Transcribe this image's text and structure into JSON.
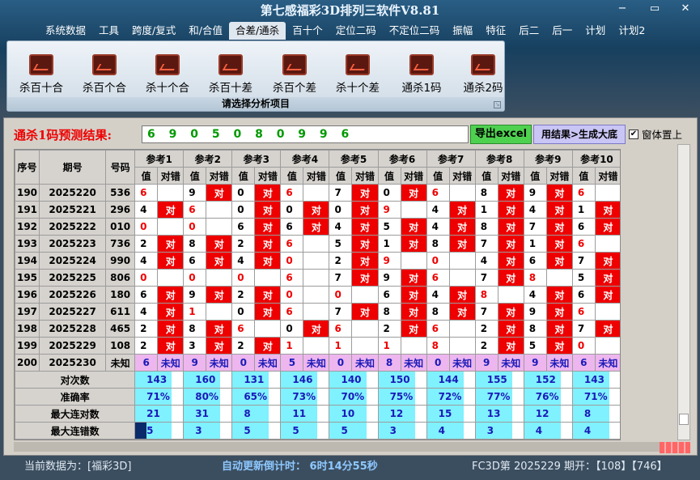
{
  "app": {
    "title": "第七感福彩3D排列三软件V8.81"
  },
  "window_controls": {
    "minimize": "−",
    "restore": "▭",
    "close": "✕"
  },
  "menu": [
    "系统数据",
    "工具",
    "跨度/复式",
    "和/合值",
    "合差/通杀",
    "百十个",
    "定位二码",
    "不定位二码",
    "振幅",
    "特征",
    "后二",
    "后一",
    "计划",
    "计划2"
  ],
  "menu_active": 4,
  "ribbon": {
    "items": [
      "杀百十合",
      "杀百个合",
      "杀十个合",
      "杀百十差",
      "杀百个差",
      "杀十个差",
      "通杀1码",
      "通杀2码"
    ],
    "caption": "请选择分析项目",
    "icon": "chart-icon"
  },
  "prediction": {
    "label": "通杀1码预测结果:",
    "value": "6 9 0 5 0 8 0 9 9 6"
  },
  "buttons": {
    "export": "导出excel",
    "generate": "用结果>生成大底"
  },
  "topmost": {
    "label": "窗体置上",
    "checked": true
  },
  "table": {
    "headers": {
      "seq": "序号",
      "issue": "期号",
      "number": "号码",
      "refs": [
        "参考1",
        "参考2",
        "参考3",
        "参考4",
        "参考5",
        "参考6",
        "参考7",
        "参考8",
        "参考9",
        "参考10"
      ],
      "value": "值",
      "result": "对错"
    },
    "rows": [
      {
        "seq": "190",
        "issue": "2025220",
        "num": "536",
        "vals": [
          "6",
          "9",
          "0",
          "6",
          "7",
          "0",
          "6",
          "8",
          "9",
          "6"
        ],
        "res": [
          "",
          "对",
          "对",
          "",
          "对",
          "对",
          "",
          "对",
          "对",
          ""
        ],
        "hit": [
          true,
          false,
          false,
          true,
          false,
          false,
          true,
          false,
          false,
          true
        ]
      },
      {
        "seq": "191",
        "issue": "2025221",
        "num": "296",
        "vals": [
          "4",
          "6",
          "0",
          "0",
          "0",
          "9",
          "4",
          "1",
          "4",
          "1"
        ],
        "res": [
          "对",
          "",
          "对",
          "对",
          "对",
          "",
          "对",
          "对",
          "对",
          "对"
        ],
        "hit": [
          false,
          true,
          false,
          false,
          false,
          true,
          false,
          false,
          false,
          false
        ]
      },
      {
        "seq": "192",
        "issue": "2025222",
        "num": "010",
        "vals": [
          "0",
          "0",
          "6",
          "6",
          "4",
          "5",
          "4",
          "8",
          "7",
          "6"
        ],
        "res": [
          "",
          "",
          "对",
          "对",
          "对",
          "对",
          "对",
          "对",
          "对",
          "对"
        ],
        "hit": [
          true,
          true,
          false,
          false,
          false,
          false,
          false,
          false,
          false,
          false
        ]
      },
      {
        "seq": "193",
        "issue": "2025223",
        "num": "736",
        "vals": [
          "2",
          "8",
          "2",
          "6",
          "5",
          "1",
          "8",
          "7",
          "1",
          "6"
        ],
        "res": [
          "对",
          "对",
          "对",
          "",
          "对",
          "对",
          "对",
          "对",
          "对",
          ""
        ],
        "hit": [
          false,
          false,
          false,
          true,
          false,
          false,
          false,
          false,
          false,
          true
        ]
      },
      {
        "seq": "194",
        "issue": "2025224",
        "num": "990",
        "vals": [
          "4",
          "6",
          "4",
          "0",
          "2",
          "9",
          "0",
          "4",
          "6",
          "7"
        ],
        "res": [
          "对",
          "对",
          "对",
          "",
          "对",
          "",
          "",
          "对",
          "对",
          "对"
        ],
        "hit": [
          false,
          false,
          false,
          true,
          false,
          true,
          true,
          false,
          false,
          false
        ]
      },
      {
        "seq": "195",
        "issue": "2025225",
        "num": "806",
        "vals": [
          "0",
          "0",
          "0",
          "6",
          "7",
          "9",
          "6",
          "7",
          "8",
          "5"
        ],
        "res": [
          "",
          "",
          "",
          "",
          "对",
          "对",
          "",
          "对",
          "",
          "对"
        ],
        "hit": [
          true,
          true,
          true,
          true,
          false,
          false,
          true,
          false,
          true,
          false
        ]
      },
      {
        "seq": "196",
        "issue": "2025226",
        "num": "180",
        "vals": [
          "6",
          "9",
          "2",
          "0",
          "0",
          "6",
          "4",
          "8",
          "4",
          "6"
        ],
        "res": [
          "对",
          "对",
          "对",
          "",
          "",
          "对",
          "对",
          "",
          "对",
          "对"
        ],
        "hit": [
          false,
          false,
          false,
          true,
          true,
          false,
          false,
          true,
          false,
          false
        ]
      },
      {
        "seq": "197",
        "issue": "2025227",
        "num": "611",
        "vals": [
          "4",
          "1",
          "0",
          "6",
          "7",
          "8",
          "8",
          "7",
          "9",
          "6"
        ],
        "res": [
          "对",
          "",
          "对",
          "",
          "对",
          "对",
          "对",
          "对",
          "对",
          ""
        ],
        "hit": [
          false,
          true,
          false,
          true,
          false,
          false,
          false,
          false,
          false,
          true
        ]
      },
      {
        "seq": "198",
        "issue": "2025228",
        "num": "465",
        "vals": [
          "2",
          "8",
          "6",
          "0",
          "6",
          "2",
          "6",
          "2",
          "8",
          "7"
        ],
        "res": [
          "对",
          "对",
          "",
          "对",
          "",
          "对",
          "",
          "对",
          "对",
          "对"
        ],
        "hit": [
          false,
          false,
          true,
          false,
          true,
          false,
          true,
          false,
          false,
          false
        ]
      },
      {
        "seq": "199",
        "issue": "2025229",
        "num": "108",
        "vals": [
          "2",
          "3",
          "2",
          "1",
          "1",
          "1",
          "8",
          "2",
          "5",
          "0"
        ],
        "res": [
          "对",
          "对",
          "对",
          "",
          "",
          "",
          "",
          "对",
          "对",
          ""
        ],
        "hit": [
          false,
          false,
          false,
          true,
          true,
          true,
          true,
          false,
          false,
          true
        ]
      },
      {
        "seq": "200",
        "issue": "2025230",
        "num": "未知",
        "vals": [
          "6",
          "9",
          "0",
          "5",
          "0",
          "8",
          "0",
          "9",
          "9",
          "6"
        ],
        "res": [
          "未知",
          "未知",
          "未知",
          "未知",
          "未知",
          "未知",
          "未知",
          "未知",
          "未知",
          "未知"
        ],
        "hit": [
          false,
          false,
          false,
          false,
          false,
          false,
          false,
          false,
          false,
          false
        ]
      }
    ],
    "stats": [
      {
        "label": "对次数",
        "values": [
          "143",
          "160",
          "131",
          "146",
          "140",
          "150",
          "144",
          "155",
          "152",
          "143"
        ]
      },
      {
        "label": "准确率",
        "values": [
          "71%",
          "80%",
          "65%",
          "73%",
          "70%",
          "75%",
          "72%",
          "77%",
          "76%",
          "71%"
        ]
      },
      {
        "label": "最大连对数",
        "values": [
          "21",
          "31",
          "8",
          "11",
          "10",
          "12",
          "15",
          "13",
          "12",
          "8"
        ]
      },
      {
        "label": "最大连错数",
        "values": [
          "5",
          "3",
          "5",
          "5",
          "5",
          "3",
          "4",
          "3",
          "4",
          "4"
        ]
      }
    ]
  },
  "status": {
    "current": "当前数据为：[福彩3D]",
    "countdown": "自动更新倒计时：  6时14分55秒",
    "draw": "FC3D第 2025229 期开：【108】【746】"
  }
}
